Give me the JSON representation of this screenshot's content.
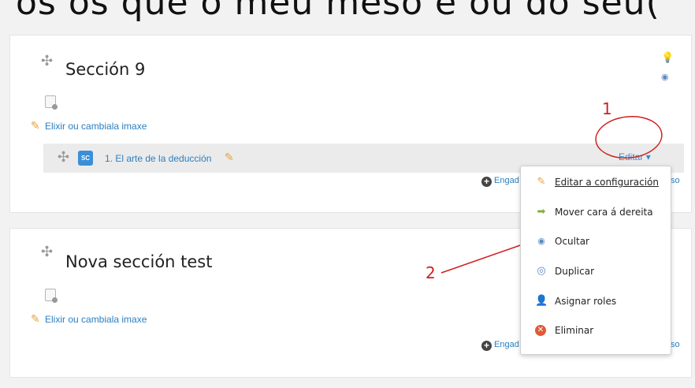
{
  "caption": "os os que ó meu  meso é ou do seu(",
  "sections": [
    {
      "title": "Sección 9",
      "image_link": "Elixir ou cambiala imaxe",
      "activity": {
        "badge": "SC",
        "name": "1. El arte de la deducción"
      },
      "edit_label": "Editar",
      "add_label": "Engad",
      "add_suffix": "so"
    },
    {
      "title": "Nova sección test",
      "image_link": "Elixir ou cambiala imaxe",
      "add_label": "Engad",
      "add_suffix": "so"
    }
  ],
  "menu": {
    "items": [
      {
        "label": "Editar a configuración",
        "icon": "pencil-icon",
        "color": "#e6a23c"
      },
      {
        "label": "Mover cara á dereita",
        "icon": "arrow-right-icon",
        "color": "#7bb33a"
      },
      {
        "label": "Ocultar",
        "icon": "eye-icon",
        "color": "#5a8ac0"
      },
      {
        "label": "Duplicar",
        "icon": "duplicate-icon",
        "color": "#5a8ac0"
      },
      {
        "label": "Asignar roles",
        "icon": "user-roles-icon",
        "color": "#c8a040"
      },
      {
        "label": "Eliminar",
        "icon": "delete-icon",
        "color": "#e05a3a"
      }
    ]
  },
  "annotations": {
    "one": "1",
    "two": "2",
    "color": "#d02020"
  }
}
